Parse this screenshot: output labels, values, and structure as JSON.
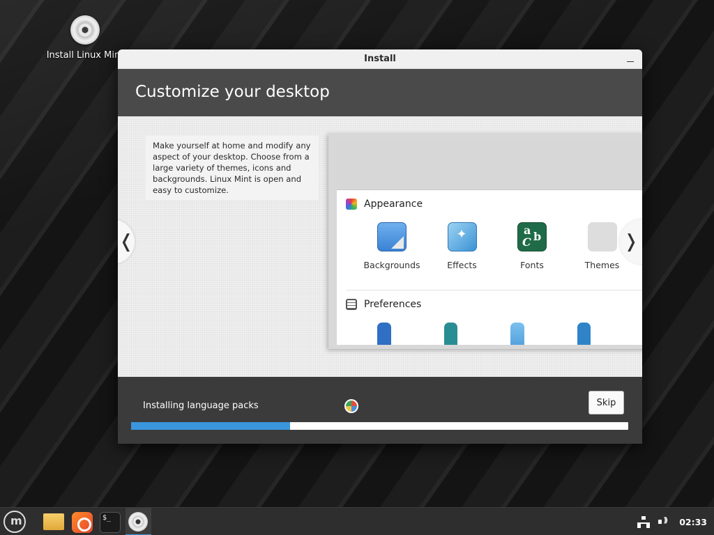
{
  "desktop": {
    "install_icon_label": "Install Linux Mint"
  },
  "window": {
    "title": "Install",
    "header_title": "Customize your desktop",
    "description": "Make yourself at home and modify any aspect of your desktop. Choose from a large variety of themes, icons and backgrounds. Linux Mint is open and easy to customize.",
    "nav_prev": "❬",
    "nav_next": "❭"
  },
  "preview": {
    "sections": [
      {
        "title": "Appearance",
        "items": [
          "Backgrounds",
          "Effects",
          "Fonts",
          "Themes"
        ]
      },
      {
        "title": "Preferences"
      }
    ]
  },
  "progress": {
    "status": "Installing language packs",
    "skip_label": "Skip",
    "fraction": 0.32
  },
  "taskbar": {
    "terminal_prompt": "$_",
    "clock": "02:33"
  },
  "colors": {
    "accent": "#3a96dc"
  }
}
